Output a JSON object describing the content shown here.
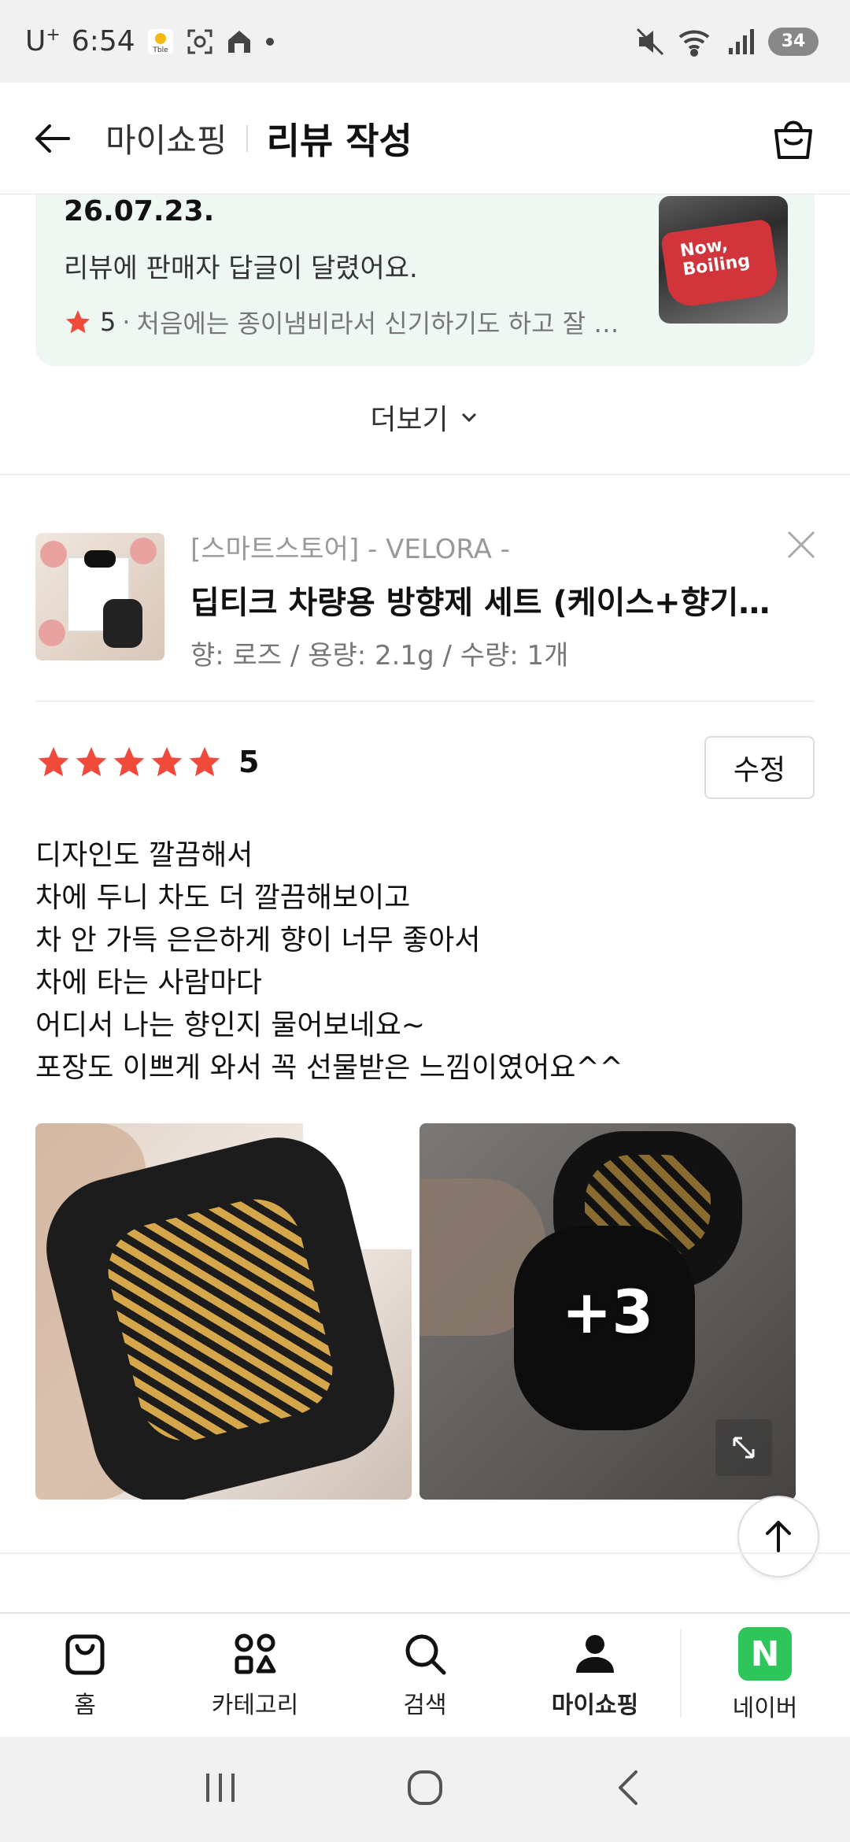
{
  "status_bar": {
    "carrier": "U",
    "carrier_sup": "+",
    "time": "6:54",
    "battery": "34"
  },
  "header": {
    "breadcrumb": "마이쇼핑",
    "title": "리뷰 작성"
  },
  "notice": {
    "date": "26.07.23.",
    "message": "리뷰에 판매자 답글이 달렸어요.",
    "score": "5",
    "separator": "·",
    "snippet": "처음에는 종이냄비라서 신기하기도 하고 잘 될...",
    "thumb_text": "Now, Boiling"
  },
  "more": {
    "label": "더보기"
  },
  "product": {
    "store": "[스마트스토어] - VELORA -",
    "name": "딥티크 차량용 방향제 세트 (케이스+향기 ...",
    "option": "향: 로즈 / 용량: 2.1g / 수량: 1개"
  },
  "rating": {
    "stars": 5,
    "score": "5",
    "edit_label": "수정"
  },
  "review": {
    "lines": [
      "디자인도 깔끔해서",
      "차에 두니 차도 더 깔끔해보이고",
      "차 안 가득 은은하게 향이 너무 좋아서",
      "차에 타는 사람마다",
      "어디서 나는 향인지 물어보네요~",
      "포장도 이쁘게 와서 꼭 선물받은 느낌이였어요^^"
    ]
  },
  "photos": {
    "more_count": "+3"
  },
  "bottom_nav": {
    "items": [
      {
        "label": "홈",
        "icon": "home-bag-icon"
      },
      {
        "label": "카테고리",
        "icon": "category-icon"
      },
      {
        "label": "검색",
        "icon": "search-icon"
      },
      {
        "label": "마이쇼핑",
        "icon": "person-icon",
        "active": true
      },
      {
        "label": "네이버",
        "icon": "naver-icon"
      }
    ],
    "naver_letter": "N"
  },
  "colors": {
    "star": "#f04a3b",
    "naver_green": "#2ec65a",
    "notice_bg": "#eef7f2"
  }
}
